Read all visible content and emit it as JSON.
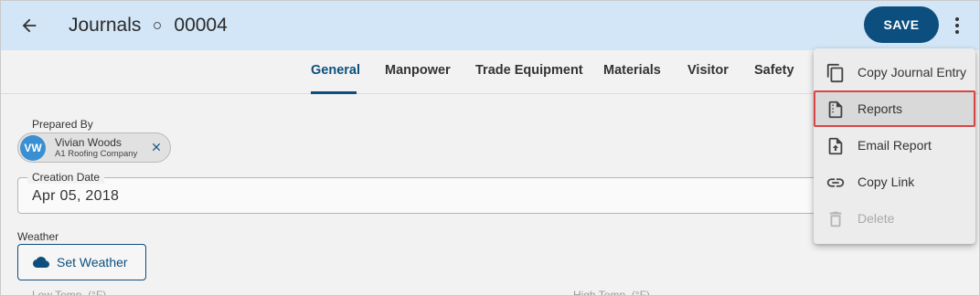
{
  "header": {
    "title": "Journals",
    "record_id": "00004",
    "save_label": "SAVE"
  },
  "tabs": [
    {
      "label": "General",
      "active": true
    },
    {
      "label": "Manpower"
    },
    {
      "label": "Trade Equipment"
    },
    {
      "label": "Materials"
    },
    {
      "label": "Visitor"
    },
    {
      "label": "Safety"
    }
  ],
  "prepared_by": {
    "label": "Prepared By",
    "initials": "VW",
    "name": "Vivian Woods",
    "company": "A1 Roofing Company"
  },
  "creation_date": {
    "label": "Creation Date",
    "value": "Apr 05, 2018"
  },
  "weather": {
    "label": "Weather",
    "button_label": "Set Weather"
  },
  "temps": {
    "low_label": "Low Temp. (°F)",
    "high_label": "High Temp. (°F)"
  },
  "menu": {
    "items": [
      {
        "label": "Copy Journal Entry",
        "icon": "copy-icon"
      },
      {
        "label": "Reports",
        "icon": "report-icon",
        "highlighted": true
      },
      {
        "label": "Email Report",
        "icon": "email-report-icon"
      },
      {
        "label": "Copy Link",
        "icon": "link-icon"
      },
      {
        "label": "Delete",
        "icon": "trash-icon",
        "disabled": true
      }
    ]
  },
  "colors": {
    "header_bg": "#d3e6f7",
    "primary": "#0c4f7e",
    "avatar": "#3a8fd2",
    "highlight_border": "#d94545"
  }
}
